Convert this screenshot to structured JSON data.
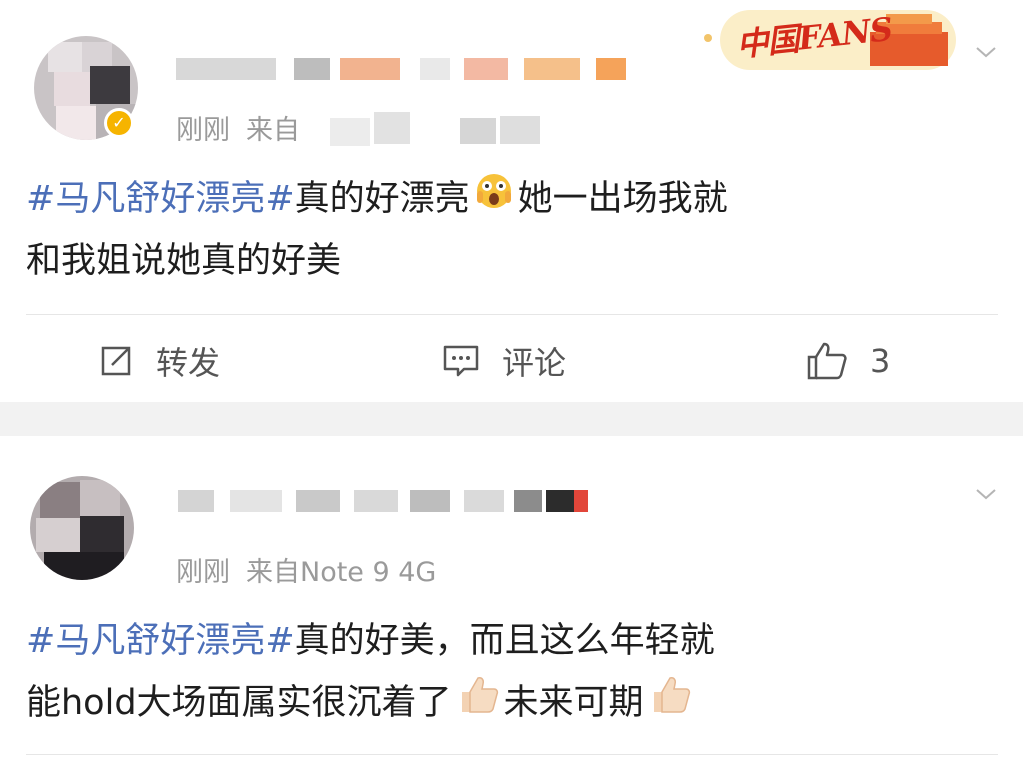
{
  "posts": [
    {
      "time": "刚刚",
      "source": "来自",
      "hashtag": "#马凡舒好漂亮#",
      "body_line1": "真的好漂亮",
      "body_line1_after": "她一出场我就",
      "body_line2": "和我姐说她真的好美",
      "badge": "中国FANS",
      "actions": {
        "repost_label": "转发",
        "comment_label": "评论",
        "like_count": "3"
      }
    },
    {
      "time": "刚刚",
      "source": "来自Note 9 4G",
      "hashtag": "#马凡舒好漂亮#",
      "body_line1": "真的好美，而且这么年轻就",
      "body_line2": "能hold大场面属实很沉着了",
      "body_line2_after": "未来可期"
    }
  ],
  "icons": [
    "repost-icon",
    "comment-icon",
    "like-icon",
    "chevron-down-icon",
    "verified-icon",
    "thumbs-up-emoji",
    "shocked-face-emoji"
  ],
  "colors": {
    "hashtag": "#4c6fb8",
    "meta": "#9a9a9a",
    "verified": "#f6b400",
    "badge": "#d42a1a"
  }
}
